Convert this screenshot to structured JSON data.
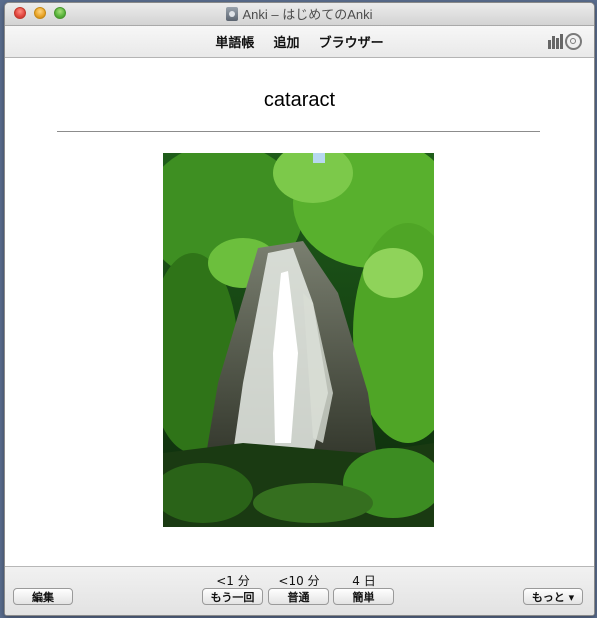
{
  "window": {
    "title": "Anki – はじめてのAnki"
  },
  "toolbar": {
    "items": [
      "単語帳",
      "追加",
      "ブラウザー"
    ],
    "icons": [
      "stats-icon",
      "sync-icon"
    ]
  },
  "card": {
    "front_text": "cataract",
    "image_alt": "waterfall photo"
  },
  "footer": {
    "edit_label": "編集",
    "more_label": "もっと ▾",
    "answers": [
      {
        "interval": "<1 分",
        "label": "もう一回"
      },
      {
        "interval": "<10 分",
        "label": "普通"
      },
      {
        "interval": "4 日",
        "label": "簡単"
      }
    ]
  }
}
